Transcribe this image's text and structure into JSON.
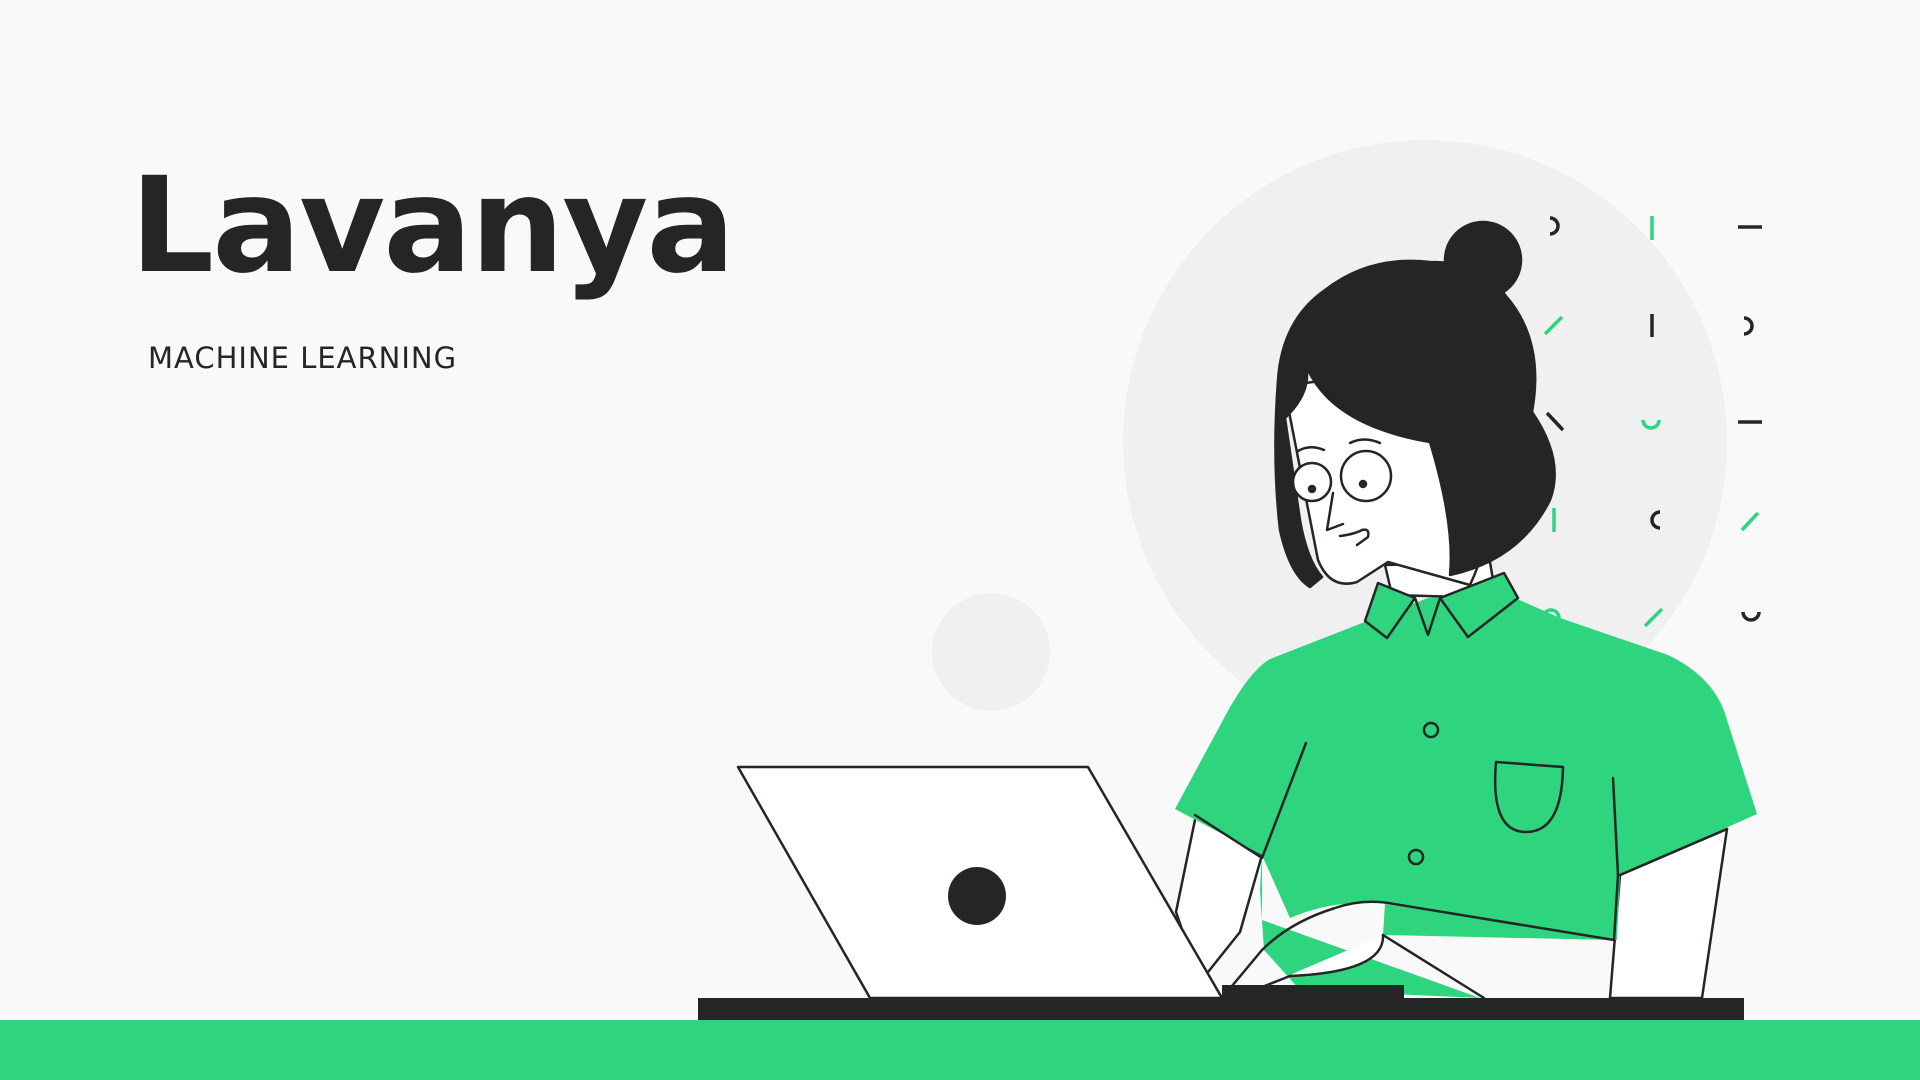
{
  "hero": {
    "name": "Lavanya",
    "tagline": "MACHINE LEARNING"
  },
  "colors": {
    "background": "#f9f9f9",
    "text": "#242626",
    "accent_green": "#2ed47e",
    "circle_gray": "#f0f0f0"
  },
  "illustration": {
    "subject": "person with glasses typing on a laptop",
    "icons": [
      "laptop-icon",
      "dot-pattern"
    ]
  }
}
